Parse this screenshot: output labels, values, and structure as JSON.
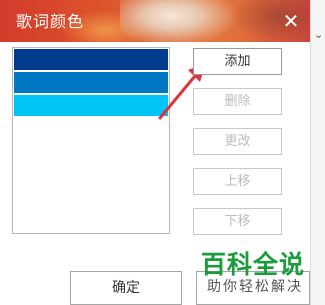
{
  "window": {
    "title": "歌词颜色"
  },
  "colors": {
    "titlebar": "#d84a2a",
    "swatches": [
      "#003b8e",
      "#0077c2",
      "#00c4f4"
    ],
    "arrow": "#e0323a",
    "watermark_green": "#1a9b3c"
  },
  "color_list": {
    "swatches": [
      {
        "color": "#003b8e",
        "selected": false
      },
      {
        "color": "#0077c2",
        "selected": false
      },
      {
        "color": "#00c4f4",
        "selected": false
      }
    ]
  },
  "buttons": {
    "add": "添加",
    "delete": "删除",
    "change": "更改",
    "move_up": "上移",
    "move_down": "下移"
  },
  "footer": {
    "ok": "确定"
  },
  "watermark": {
    "line1": "百科全说",
    "line2": "助你轻松解决"
  }
}
